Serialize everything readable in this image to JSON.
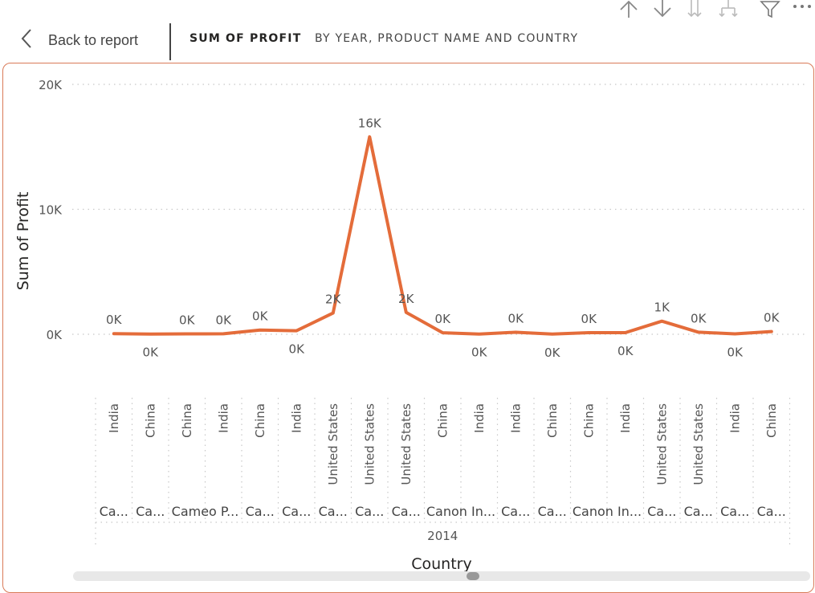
{
  "header": {
    "back_label": "Back to report",
    "breadcrumb_primary": "SUM OF PROFIT",
    "breadcrumb_secondary": "BY YEAR, PRODUCT NAME AND COUNTRY"
  },
  "toolbar": {
    "icons": [
      "drill-up-icon",
      "drill-down-icon",
      "expand-all-icon",
      "expand-hierarchy-icon",
      "filter-icon",
      "more-options-icon"
    ]
  },
  "colors": {
    "line": "#e46c3a",
    "accent": "#d97a58"
  },
  "chart_data": {
    "type": "line",
    "title": "",
    "xlabel": "Country",
    "ylabel": "Sum of Profit",
    "ylim": [
      0,
      20000
    ],
    "yticks": [
      0,
      10000,
      20000
    ],
    "ytick_labels": [
      "0K",
      "10K",
      "20K"
    ],
    "grid": true,
    "categories": [
      "India",
      "China",
      "China",
      "India",
      "China",
      "India",
      "United States",
      "United States",
      "United States",
      "China",
      "India",
      "India",
      "China",
      "China",
      "India",
      "United States",
      "United States",
      "India",
      "China"
    ],
    "product_labels": [
      "Ca...",
      "Ca...",
      "Cameo P...",
      "Ca...",
      "Ca...",
      "Ca...",
      "Ca...",
      "Ca...",
      "Canon In...",
      "Ca...",
      "Ca...",
      "Canon In...",
      "Ca...",
      "Ca...",
      "Ca...",
      "Ca..."
    ],
    "product_spans": [
      1,
      1,
      2,
      1,
      1,
      1,
      1,
      1,
      2,
      1,
      1,
      2,
      1,
      1,
      1,
      1
    ],
    "year_label": "2014",
    "values": [
      50,
      20,
      30,
      40,
      340,
      280,
      1700,
      15800,
      1750,
      120,
      20,
      160,
      10,
      130,
      130,
      1050,
      170,
      30,
      220
    ],
    "data_labels": [
      "0K",
      "0K",
      "0K",
      "0K",
      "0K",
      "0K",
      "2K",
      "16K",
      "2K",
      "0K",
      "0K",
      "0K",
      "0K",
      "0K",
      "0K",
      "1K",
      "0K",
      "0K",
      "0K"
    ],
    "label_positions": [
      "above",
      "below",
      "above",
      "above",
      "above",
      "below",
      "above",
      "above",
      "above",
      "above",
      "below",
      "above",
      "below",
      "above",
      "below",
      "above",
      "above",
      "below",
      "above"
    ]
  }
}
